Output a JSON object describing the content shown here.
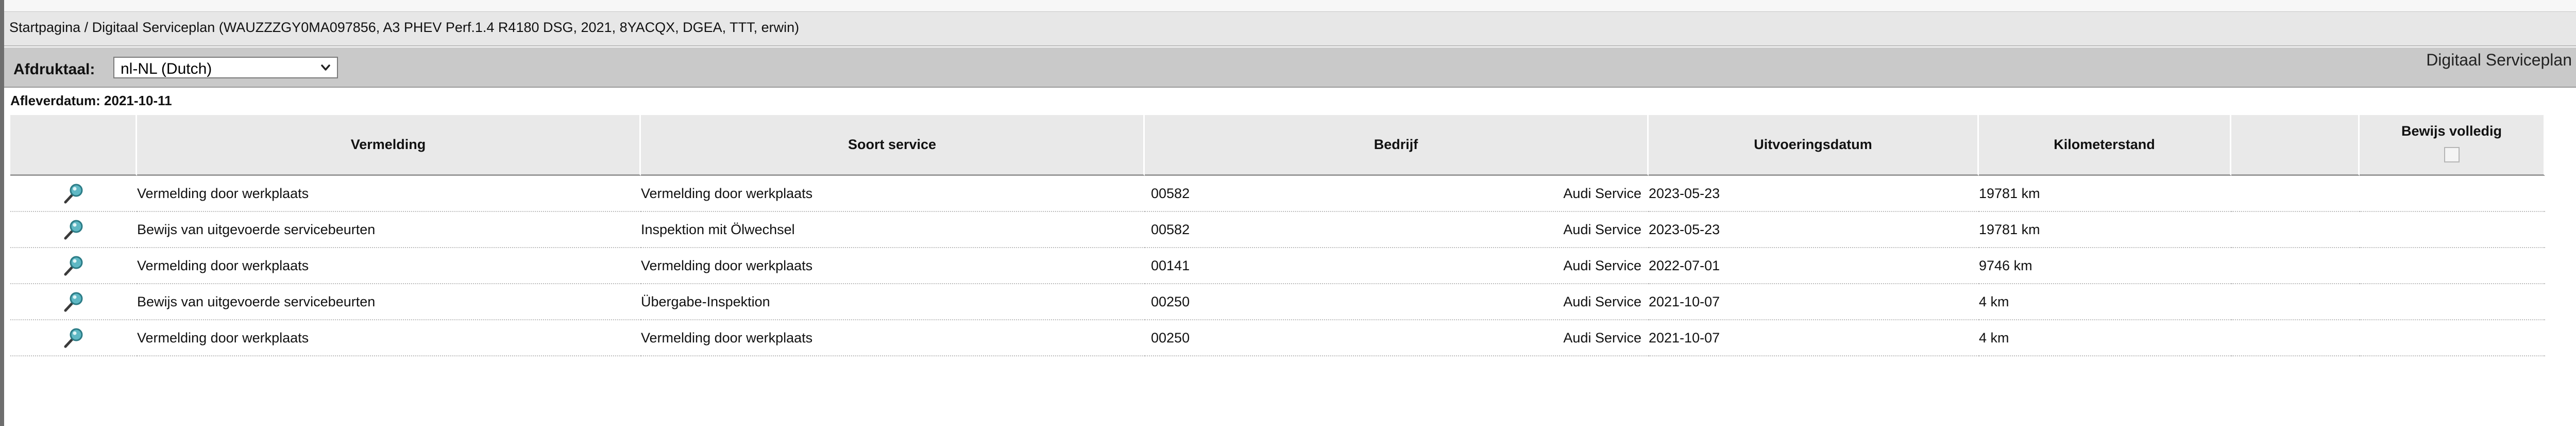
{
  "breadcrumb": {
    "text": "Startpagina / Digitaal Serviceplan (WAUZZZGY0MA097856, A3 PHEV Perf.1.4 R4180 DSG, 2021, 8YACQX, DGEA, TTT, erwin)"
  },
  "toolbar": {
    "language_label": "Afdruktaal:",
    "language_selected": "nl-NL (Dutch)",
    "page_heading": "Digitaal Serviceplan"
  },
  "delivery": {
    "text": "Afleverdatum: 2021-10-11"
  },
  "table": {
    "headers": {
      "view": "",
      "entry": "Vermelding",
      "service_type": "Soort service",
      "company": "Bedrijf",
      "date": "Uitvoeringsdatum",
      "mileage": "Kilometerstand",
      "extra": "",
      "proof_complete": "Bewijs volledig"
    },
    "rows": [
      {
        "entry": "Vermelding door werkplaats",
        "service_type": "Vermelding door werkplaats",
        "company_code": "00582",
        "company_name": "Audi Service",
        "date": "2023-05-23",
        "mileage": "19781 km"
      },
      {
        "entry": "Bewijs van uitgevoerde servicebeurten",
        "service_type": "Inspektion mit Ölwechsel",
        "company_code": "00582",
        "company_name": "Audi Service",
        "date": "2023-05-23",
        "mileage": "19781 km"
      },
      {
        "entry": "Vermelding door werkplaats",
        "service_type": "Vermelding door werkplaats",
        "company_code": "00141",
        "company_name": "Audi Service",
        "date": "2022-07-01",
        "mileage": "9746 km"
      },
      {
        "entry": "Bewijs van uitgevoerde servicebeurten",
        "service_type": "Übergabe-Inspektion",
        "company_code": "00250",
        "company_name": "Audi Service",
        "date": "2021-10-07",
        "mileage": "4 km"
      },
      {
        "entry": "Vermelding door werkplaats",
        "service_type": "Vermelding door werkplaats",
        "company_code": "00250",
        "company_name": "Audi Service",
        "date": "2021-10-07",
        "mileage": "4 km"
      }
    ]
  },
  "icons": {
    "view": "magnifier-icon",
    "dropdown": "chevron-down-icon"
  },
  "colors": {
    "toolbar_bg": "#c9c9c9",
    "header_bg": "#e9e9e9",
    "magnifier_lens": "#5fb8c4"
  }
}
